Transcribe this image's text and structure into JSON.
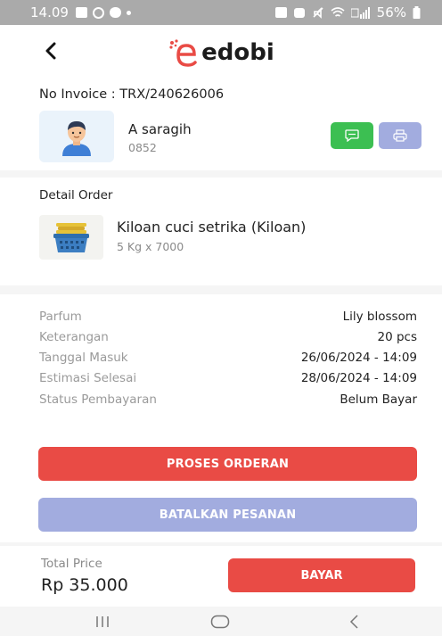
{
  "status_bar": {
    "time": "14.09",
    "battery": "56%",
    "network_label": "Vo\nLTE"
  },
  "app": {
    "logo_text": "edobi"
  },
  "customer": {
    "invoice_label": "No Invoice : TRX/240626006",
    "name": "A saragih",
    "phone": "0852"
  },
  "order": {
    "title": "Detail Order",
    "item_name": "Kiloan cuci setrika (Kiloan)",
    "item_qty": "5 Kg x 7000"
  },
  "details": [
    {
      "label": "Parfum",
      "value": "Lily blossom"
    },
    {
      "label": "Keterangan",
      "value": "20 pcs"
    },
    {
      "label": "Tanggal Masuk",
      "value": "26/06/2024 - 14:09"
    },
    {
      "label": "Estimasi Selesai",
      "value": "28/06/2024 - 14:09"
    },
    {
      "label": "Status Pembayaran",
      "value": "Belum Bayar"
    }
  ],
  "actions": {
    "proses_label": "PROSES ORDERAN",
    "batal_label": "BATALKAN PESANAN"
  },
  "footer": {
    "total_label": "Total Price",
    "total_value": "Rp 35.000",
    "bayar_label": "BAYAR"
  },
  "colors": {
    "primary_red": "#e94b45",
    "soft_purple": "#a2acdf",
    "chat_green": "#3cbf52"
  },
  "icons": [
    "back-arrow-icon",
    "chat-icon",
    "printer-icon",
    "avatar-icon",
    "laundry-basket-icon",
    "recent-apps-icon",
    "home-icon",
    "back-nav-icon"
  ]
}
